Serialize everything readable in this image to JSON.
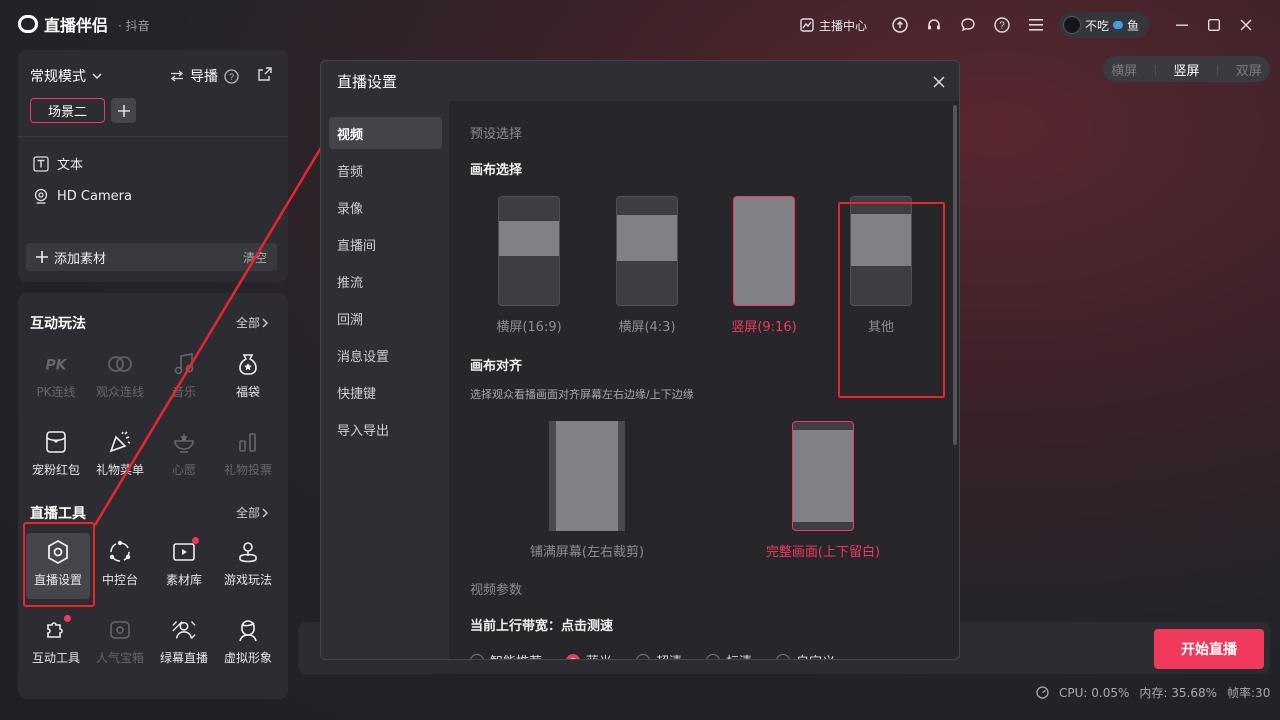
{
  "app": {
    "name": "直播伴侣",
    "platform": "· 抖音",
    "anchor_center": "主播中心",
    "user_name": "不吃",
    "user_suffix": "鱼"
  },
  "scene_panel": {
    "mode": "常规模式",
    "guide": "导播",
    "scene_tab": "场景二",
    "sources": [
      "文本",
      "HD Camera"
    ],
    "add_source": "添加素材",
    "clear": "清空"
  },
  "interactive": {
    "title": "互动玩法",
    "more": "全部",
    "items": [
      "PK连线",
      "观众连线",
      "音乐",
      "福袋",
      "宠粉红包",
      "礼物菜单",
      "心愿",
      "礼物投票"
    ]
  },
  "live_tools": {
    "title": "直播工具",
    "more": "全部",
    "items": [
      "直播设置",
      "中控台",
      "素材库",
      "游戏玩法",
      "互动工具",
      "人气宝箱",
      "绿幕直播",
      "虚拟形象"
    ]
  },
  "orientation": {
    "options": [
      "横屏",
      "竖屏",
      "双屏"
    ],
    "active": "竖屏"
  },
  "bottom": {
    "start_button": "开始直播",
    "cpu": "CPU: 0.05%",
    "memory": "内存: 35.68%",
    "fps": "帧率:30"
  },
  "modal": {
    "title": "直播设置",
    "nav": [
      "视频",
      "音频",
      "录像",
      "直播间",
      "推流",
      "回溯",
      "消息设置",
      "快捷键",
      "导入导出"
    ],
    "active_nav": "视频",
    "preset_label": "预设选择",
    "canvas_title": "画布选择",
    "canvas_options": [
      {
        "label": "横屏(16:9)"
      },
      {
        "label": "横屏(4:3)"
      },
      {
        "label": "竖屏(9:16)"
      },
      {
        "label": "其他"
      }
    ],
    "canvas_selected": "竖屏(9:16)",
    "align_title": "画布对齐",
    "align_desc": "选择观众看播画面对齐屏幕左右边缘/上下边缘",
    "align_options": [
      {
        "label": "铺满屏幕(左右裁剪)"
      },
      {
        "label": "完整画面(上下留白)"
      }
    ],
    "align_selected": "完整画面(上下留白)",
    "video_params_label": "视频参数",
    "bandwidth": "当前上行带宽：点击测速",
    "quality_options": [
      "智能推荐",
      "蓝光",
      "超清",
      "标清",
      "自定义"
    ],
    "quality_selected": "蓝光"
  },
  "colors": {
    "accent": "#f0395b",
    "highlight_box": "#e8262b",
    "panel": "#2c2c32"
  }
}
